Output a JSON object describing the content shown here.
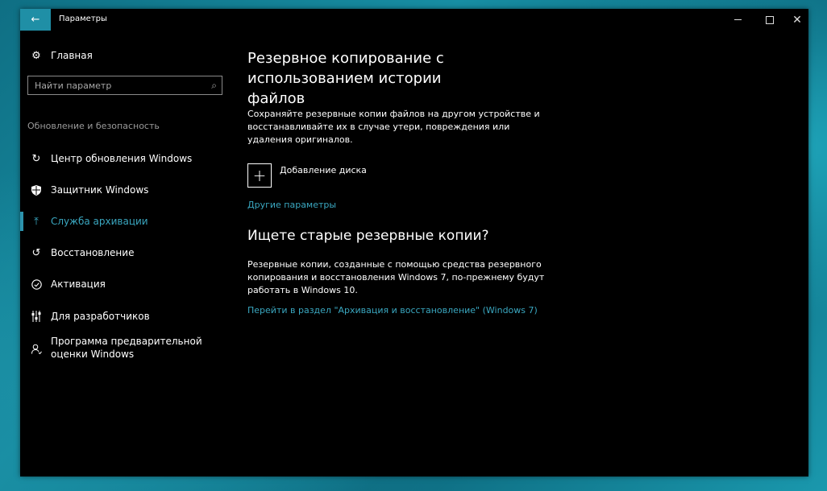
{
  "window": {
    "title": "Параметры",
    "back_icon": "back-arrow-icon",
    "controls": {
      "minimize": "minimize-icon",
      "maximize": "maximize-icon",
      "close": "close-icon",
      "close_glyph": "✕"
    }
  },
  "sidebar": {
    "home_label": "Главная",
    "search_placeholder": "Найти параметр",
    "section_label": "Обновление и безопасность",
    "items": [
      {
        "label": "Центр обновления Windows",
        "icon": "refresh-icon"
      },
      {
        "label": "Защитник Windows",
        "icon": "shield-icon"
      },
      {
        "label": "Служба архивации",
        "icon": "backup-arrow-icon",
        "active": true
      },
      {
        "label": "Восстановление",
        "icon": "history-icon"
      },
      {
        "label": "Активация",
        "icon": "checkmark-circle-icon"
      },
      {
        "label": "Для разработчиков",
        "icon": "developer-sliders-icon"
      },
      {
        "label": "Программа предварительной оценки Windows",
        "icon": "insider-person-icon"
      }
    ]
  },
  "main": {
    "heading": "Резервное копирование с использованием истории файлов",
    "description": "Сохраняйте резервные копии файлов на другом устройстве и восстанавливайте их в случае утери, повреждения или удаления оригиналов.",
    "add_drive_label": "Добавление диска",
    "more_options_link": "Другие параметры",
    "old_backups_heading": "Ищете старые резервные копии?",
    "old_backups_description": "Резервные копии, созданные с помощью средства резервного копирования и восстановления Windows 7, по-прежнему будут работать в Windows 10.",
    "old_backups_link": "Перейти в раздел \"Архивация и восстановление\" (Windows 7)"
  },
  "colors": {
    "accent": "#2c93ad",
    "link": "#3aa7c0",
    "background": "#000000",
    "text": "#ffffff",
    "muted": "#9a9a9a"
  }
}
